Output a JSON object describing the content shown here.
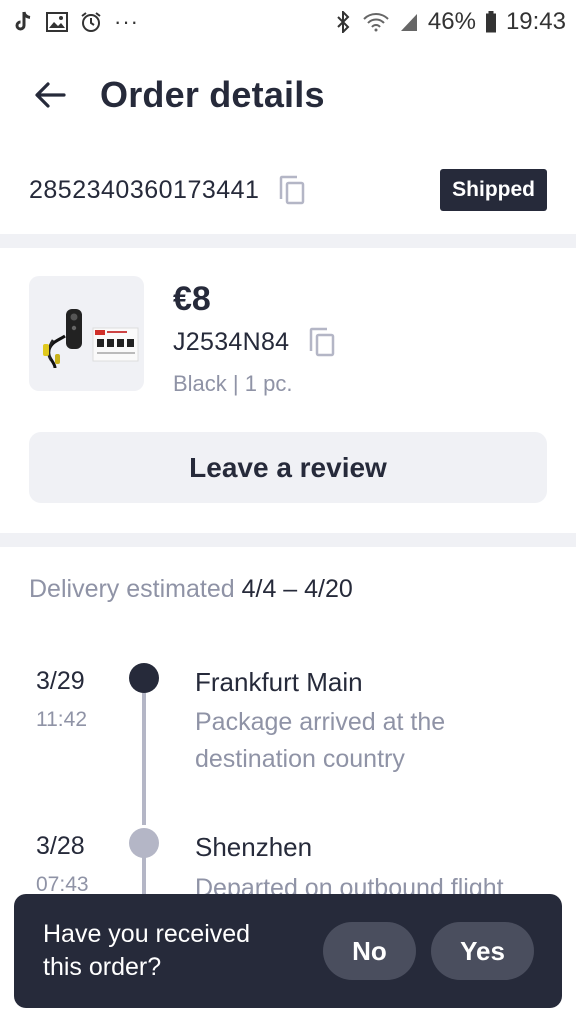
{
  "status_bar": {
    "icons_left": [
      "tiktok-icon",
      "image-icon",
      "alarm-icon",
      "more-dots-icon"
    ],
    "icons_right": [
      "bluetooth-icon",
      "wifi-icon",
      "signal-icon",
      "battery-icon"
    ],
    "battery": "46%",
    "time": "19:43"
  },
  "header": {
    "title": "Order details"
  },
  "order": {
    "id": "2852340360173441",
    "status": "Shipped"
  },
  "product": {
    "price": "€8",
    "sku": "J2534N84",
    "variant": "Black | 1 pc.",
    "review_label": "Leave a review"
  },
  "delivery": {
    "label": "Delivery estimated",
    "range": "4/4 – 4/20"
  },
  "timeline": [
    {
      "date": "3/29",
      "time": "11:42",
      "place": "Frankfurt Main",
      "description": "Package arrived at the destination country",
      "active": true
    },
    {
      "date": "3/28",
      "time": "07:43",
      "place": "Shenzhen",
      "description": "Departed on outbound flight",
      "active": false
    }
  ],
  "prompt": {
    "question": "Have you received this order?",
    "no_label": "No",
    "yes_label": "Yes"
  },
  "colors": {
    "dark": "#262a3a",
    "muted": "#8f93a6",
    "light_bg": "#f0f1f5",
    "timeline_inactive": "#b4b6c6"
  }
}
